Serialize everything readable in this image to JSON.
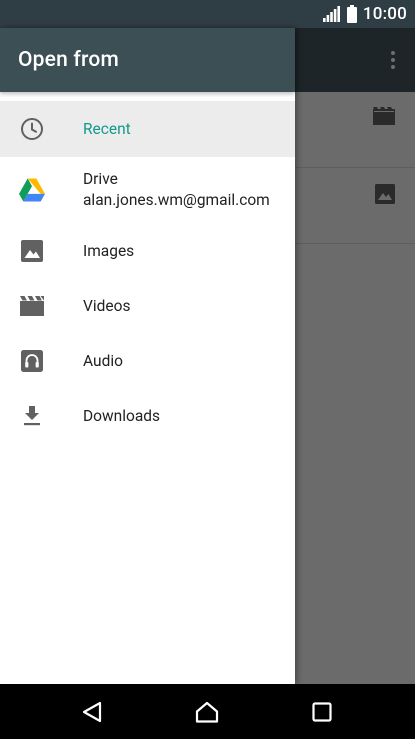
{
  "status_bar": {
    "time": "10:00",
    "icons": [
      "signal-icon",
      "battery-icon"
    ]
  },
  "drawer": {
    "title": "Open from",
    "accent_color": "#12998a",
    "header_color": "#3c4f55",
    "items": [
      {
        "label": "Recent",
        "icon": "clock-icon",
        "selected": true
      },
      {
        "label": "Drive",
        "summary": "alan.jones.wm@gmail.com",
        "icon": "google-drive-icon"
      },
      {
        "label": "Images",
        "icon": "image-icon"
      },
      {
        "label": "Videos",
        "icon": "film-icon"
      },
      {
        "label": "Audio",
        "icon": "headphones-icon"
      },
      {
        "label": "Downloads",
        "icon": "download-icon"
      }
    ]
  },
  "background_app": {
    "overflow_icon": "more-vert-icon",
    "rows": [
      {
        "icon": "film-icon"
      },
      {
        "icon": "image-icon"
      }
    ]
  },
  "nav_bar": {
    "buttons": [
      "back-icon",
      "home-icon",
      "recents-icon"
    ]
  }
}
